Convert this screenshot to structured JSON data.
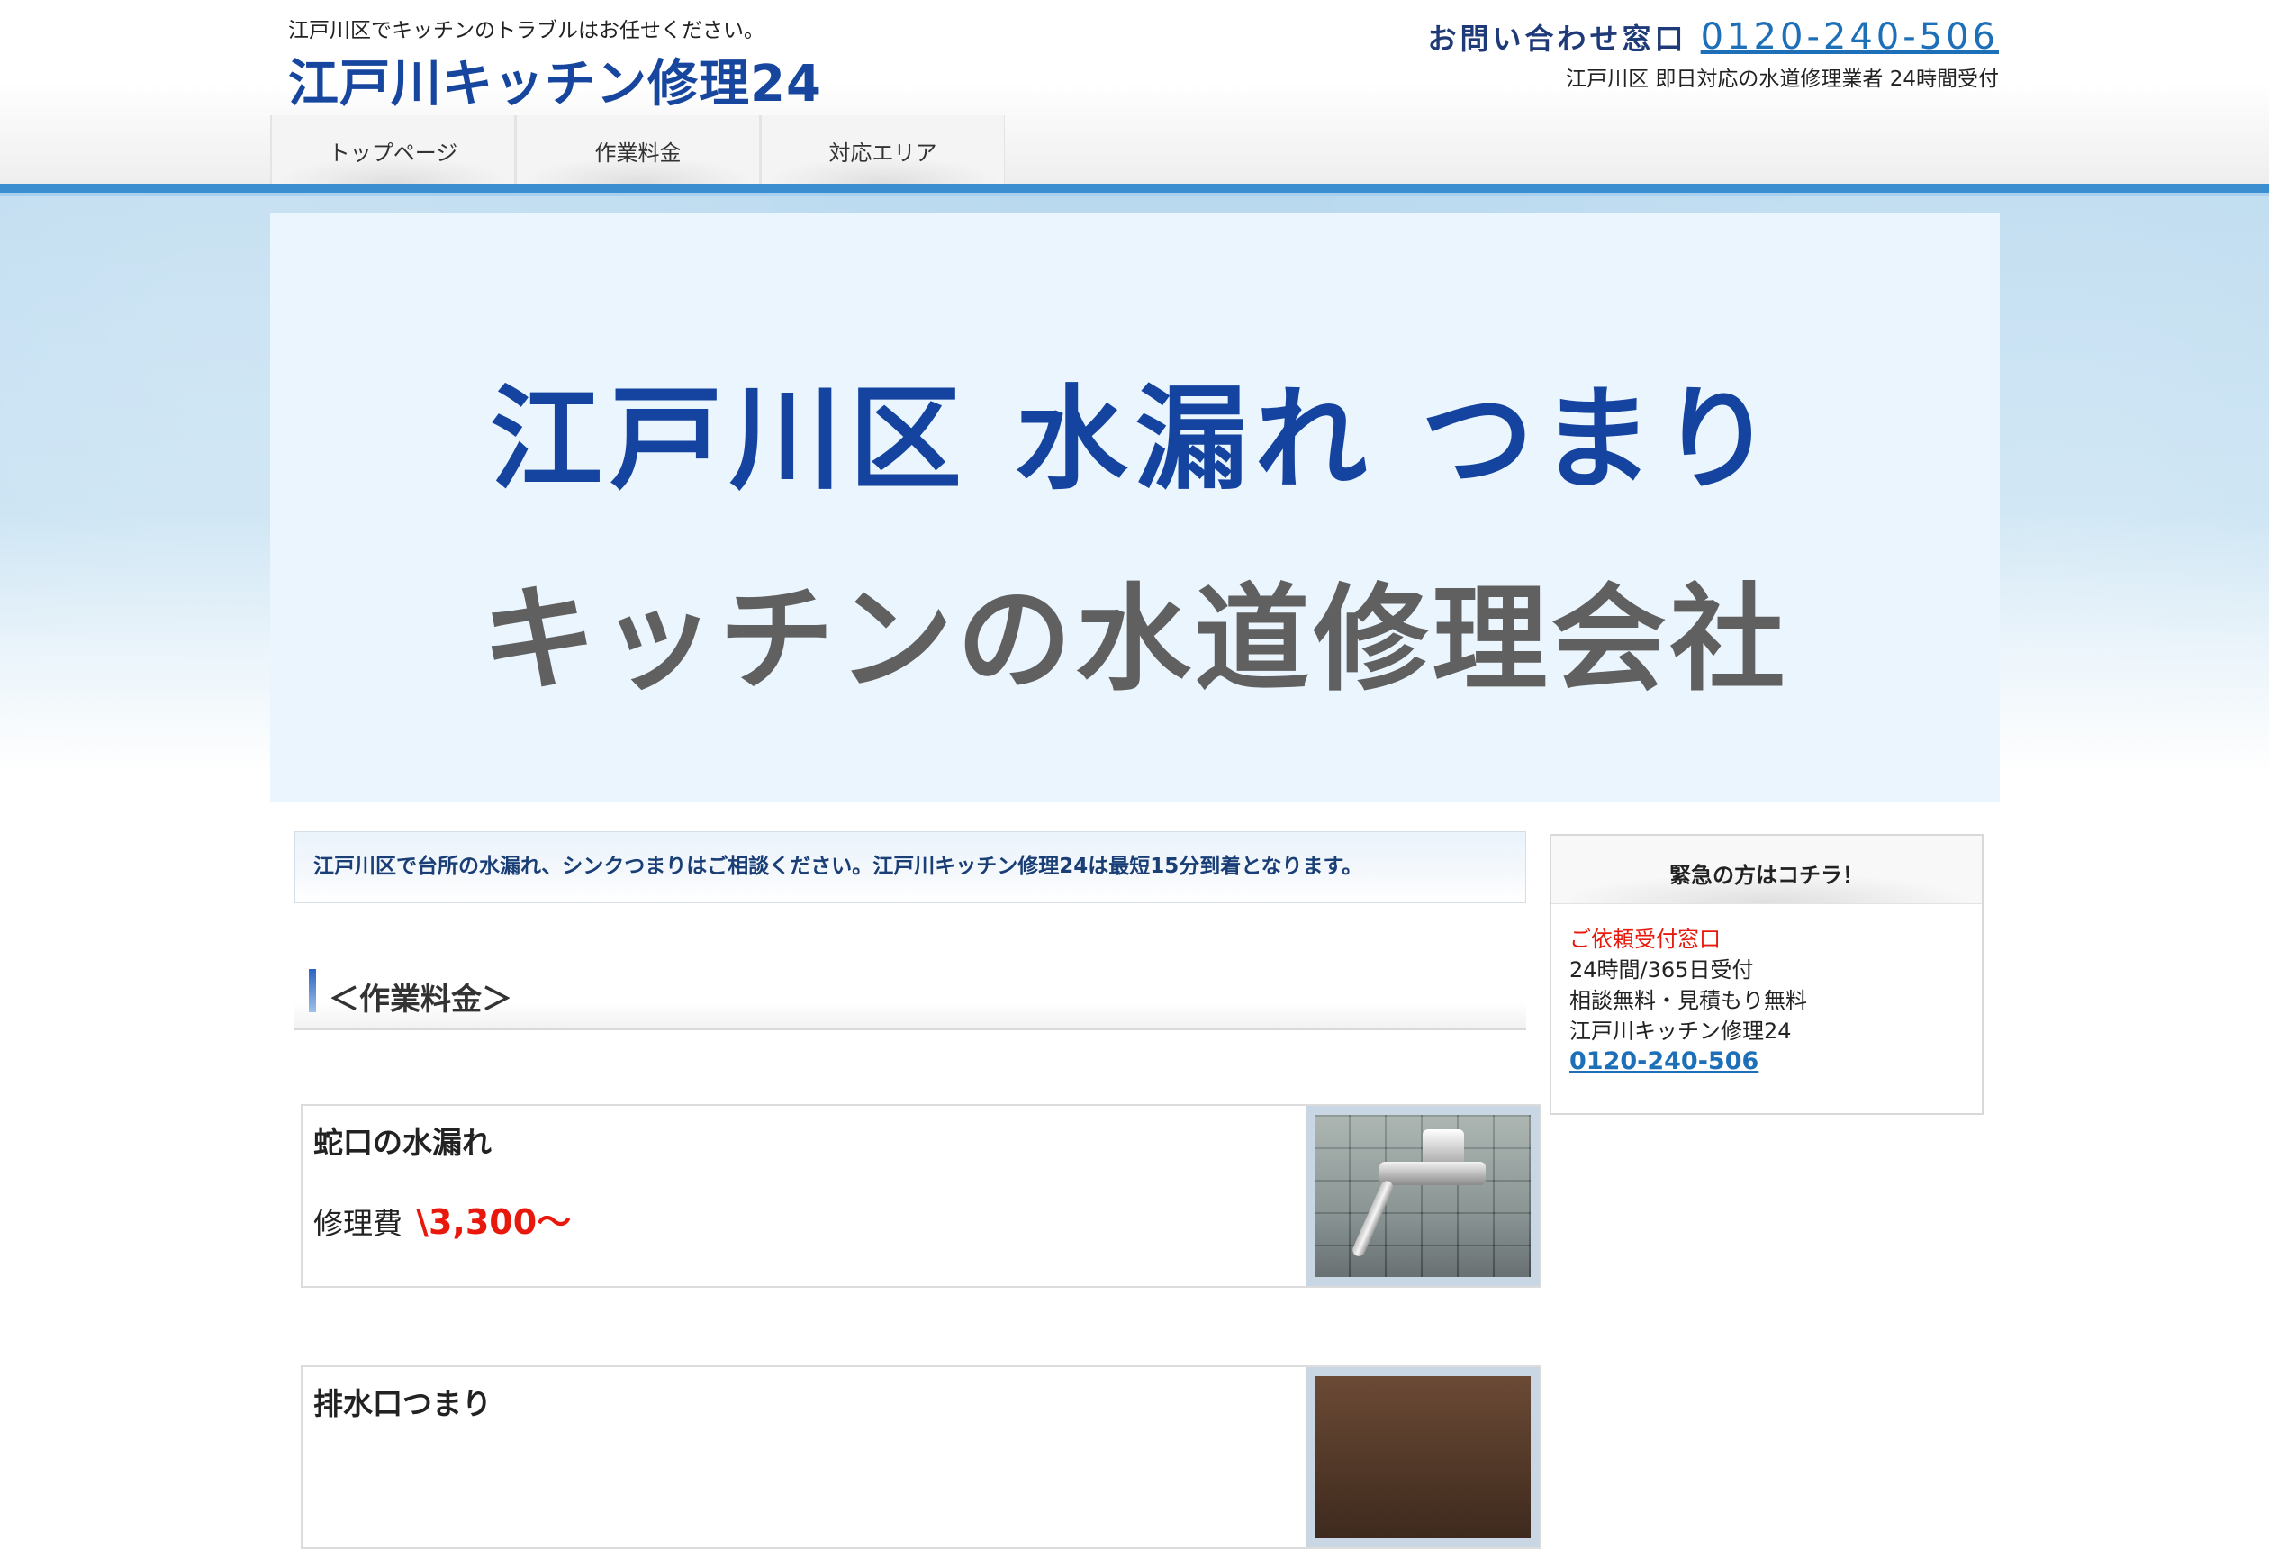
{
  "header": {
    "tagline": "江戸川区でキッチンのトラブルはお任せください。",
    "logo": "江戸川キッチン修理24",
    "contact_label": "お問い合わせ窓口",
    "contact_phone": "0120-240-506",
    "contact_sub": "江戸川区 即日対応の水道修理業者 24時間受付"
  },
  "nav": [
    {
      "label": "トップページ"
    },
    {
      "label": "作業料金"
    },
    {
      "label": "対応エリア"
    }
  ],
  "hero": {
    "line1": "江戸川区 水漏れ つまり",
    "line2": "キッチンの水道修理会社"
  },
  "intro": "江戸川区で台所の水漏れ、シンクつまりはご相談ください。江戸川キッチン修理24は最短15分到着となります。",
  "section_title": "＜作業料金＞",
  "cards": [
    {
      "title": "蛇口の水漏れ",
      "price_label": "修理費",
      "price": "\\3,300〜"
    },
    {
      "title": "排水口つまり"
    }
  ],
  "sidebar": {
    "title": "緊急の方はコチラ！",
    "line1": "ご依頼受付窓口",
    "line2": "24時間/365日受付",
    "line3": "相談無料・見積もり無料",
    "line4": "江戸川キッチン修理24",
    "phone": "0120-240-506"
  },
  "colors": {
    "brand_blue": "#17469e",
    "accent_red": "#e8190c",
    "link_blue": "#1d6fb8"
  }
}
